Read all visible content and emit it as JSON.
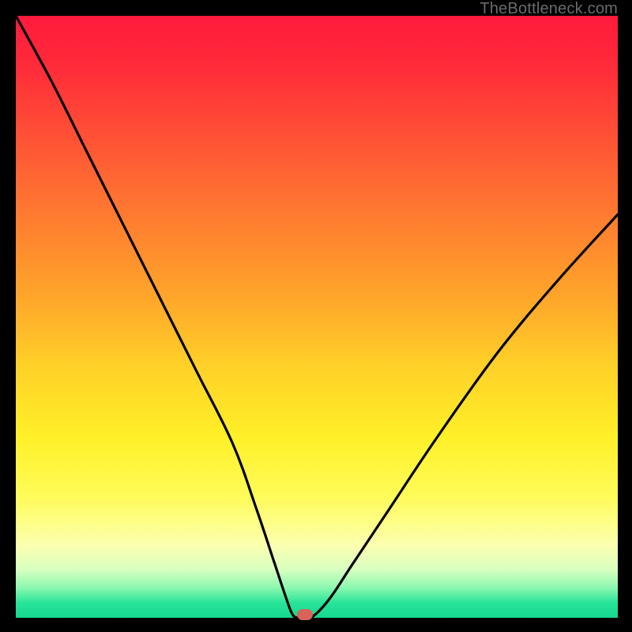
{
  "watermark": {
    "text": "TheBottleneck.com"
  },
  "chart_data": {
    "type": "line",
    "title": "",
    "xlabel": "",
    "ylabel": "",
    "xlim": [
      0,
      100
    ],
    "ylim": [
      0,
      100
    ],
    "grid": false,
    "legend": false,
    "series": [
      {
        "name": "bottleneck-curve",
        "x": [
          0,
          6,
          12,
          18,
          24,
          30,
          36,
          40,
          43,
          45,
          46,
          47,
          49,
          52,
          56,
          62,
          70,
          80,
          90,
          100
        ],
        "values": [
          100,
          89,
          77,
          65,
          53,
          41,
          29,
          18,
          9,
          3,
          0.5,
          0,
          0,
          3,
          9,
          18,
          30,
          44,
          56,
          67
        ]
      }
    ],
    "marker": {
      "x": 48,
      "y": 0,
      "color": "#d9635a"
    },
    "gradient_stops": [
      {
        "pos": 0,
        "color": "#ff1a3c"
      },
      {
        "pos": 0.7,
        "color": "#fff028"
      },
      {
        "pos": 0.95,
        "color": "#8cf8b0"
      },
      {
        "pos": 1.0,
        "color": "#14d890"
      }
    ]
  }
}
